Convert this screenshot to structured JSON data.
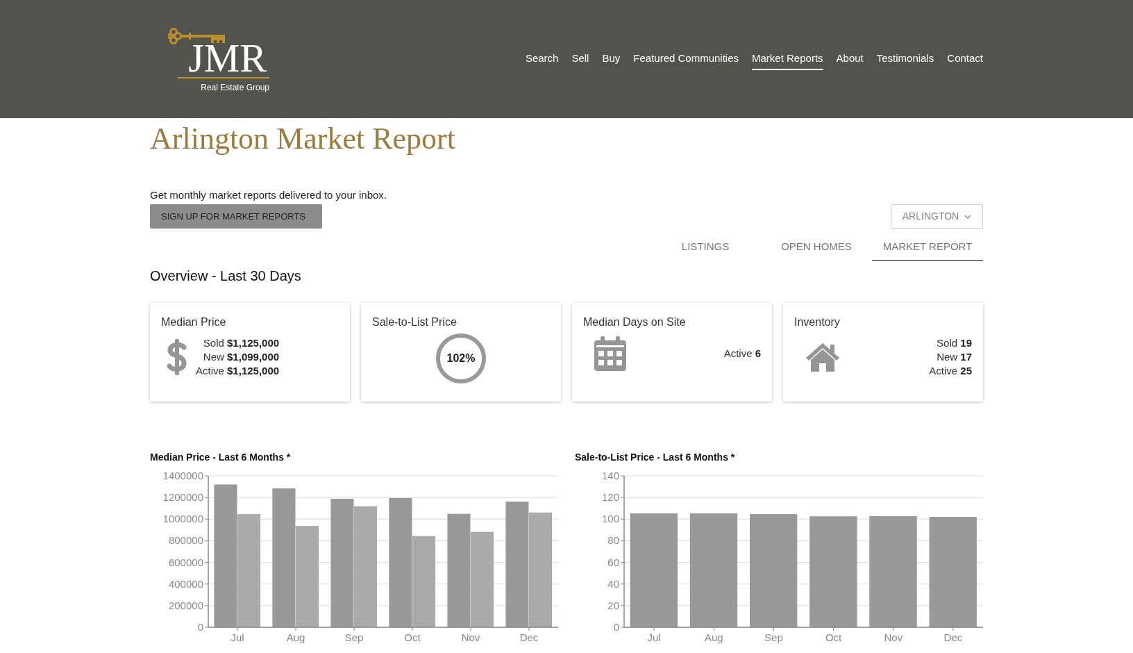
{
  "header": {
    "logo": {
      "letters": "JMR",
      "tagline": "Real Estate Group"
    },
    "nav": [
      {
        "label": "Search",
        "selected": false
      },
      {
        "label": "Sell",
        "selected": false
      },
      {
        "label": "Buy",
        "selected": false
      },
      {
        "label": "Featured Communities",
        "selected": false
      },
      {
        "label": "Market Reports",
        "selected": true
      },
      {
        "label": "About",
        "selected": false
      },
      {
        "label": "Testimonials",
        "selected": false
      },
      {
        "label": "Contact",
        "selected": false
      }
    ]
  },
  "page_title": "Arlington Market Report",
  "signup": {
    "text": "Get monthly market reports delivered to your inbox.",
    "button": "SIGN UP FOR MARKET REPORTS"
  },
  "area_select": {
    "value": "ARLINGTON"
  },
  "tabs": [
    {
      "label": "LISTINGS",
      "selected": false
    },
    {
      "label": "OPEN HOMES",
      "selected": false
    },
    {
      "label": "MARKET REPORT",
      "selected": true
    }
  ],
  "overview_heading": "Overview - Last 30 Days",
  "cards": [
    {
      "kind": "price",
      "title": "Median Price",
      "lines": [
        {
          "label": "Sold",
          "value": "$1,125,000"
        },
        {
          "label": "New",
          "value": "$1,099,000"
        },
        {
          "label": "Active",
          "value": "$1,125,000"
        }
      ]
    },
    {
      "kind": "gauge",
      "title": "Sale-to-List Price",
      "value": "102%"
    },
    {
      "kind": "days",
      "title": "Median Days on Site",
      "lines": [
        {
          "label": "Active",
          "value": "6"
        }
      ]
    },
    {
      "kind": "inventory",
      "title": "Inventory",
      "lines": [
        {
          "label": "Sold",
          "value": "19"
        },
        {
          "label": "New",
          "value": "17"
        },
        {
          "label": "Active",
          "value": "25"
        }
      ]
    }
  ],
  "charts": [
    {
      "title": "Median Price - Last 6 Months *",
      "chart_data": {
        "type": "bar",
        "grid": true,
        "categories": [
          "Jul",
          "Aug",
          "Sep",
          "Oct",
          "Nov",
          "Dec"
        ],
        "ylim": [
          0,
          1400000
        ],
        "yticks": [
          0,
          200000,
          400000,
          600000,
          800000,
          1000000,
          1200000,
          1400000
        ],
        "series": [
          {
            "color": "#999999",
            "values": [
              1320000,
              1284000,
              1188000,
              1195000,
              1049000,
              1162000
            ]
          },
          {
            "color": "#aaaaaa",
            "values": [
              1046000,
              937000,
              1119000,
              844000,
              882000,
              1061000
            ]
          }
        ]
      }
    },
    {
      "title": "Sale-to-List Price - Last 6 Months *",
      "chart_data": {
        "type": "bar",
        "grid": true,
        "categories": [
          "Jul",
          "Aug",
          "Sep",
          "Oct",
          "Nov",
          "Dec"
        ],
        "ylim": [
          0,
          140
        ],
        "yticks": [
          0,
          20,
          40,
          60,
          80,
          100,
          120,
          140
        ],
        "series": [
          {
            "color": "#999999",
            "values": [
              105.3,
              105.3,
              104.6,
              102.6,
              102.8,
              102.1
            ]
          }
        ]
      }
    }
  ]
}
